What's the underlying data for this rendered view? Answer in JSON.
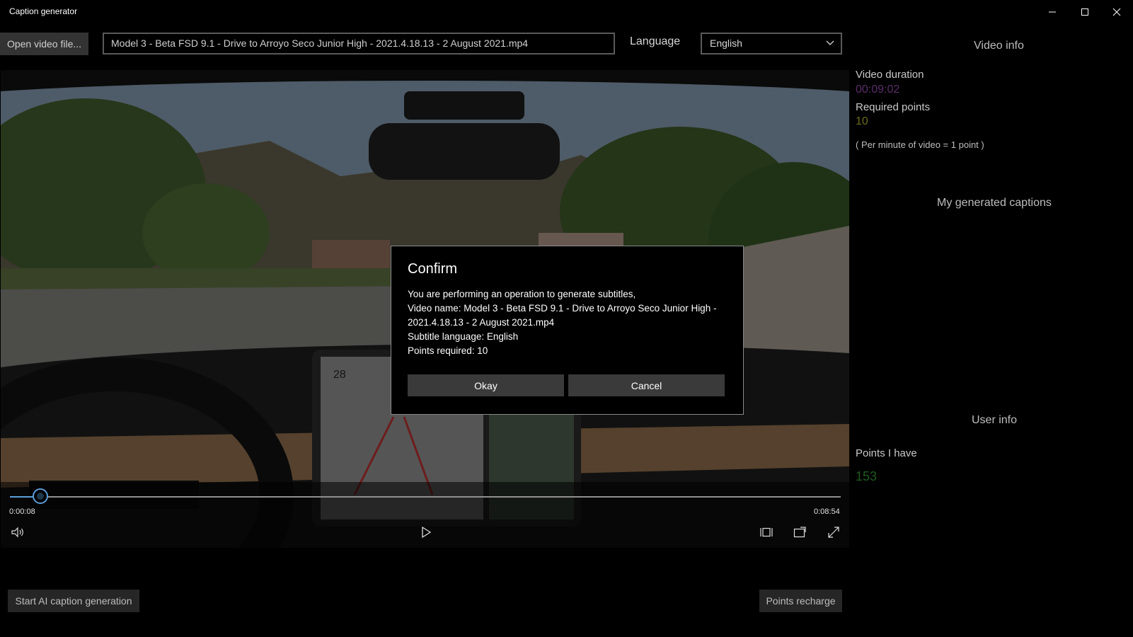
{
  "window": {
    "title": "Caption generator"
  },
  "toolbar": {
    "open_label": "Open video file...",
    "file_value": "Model 3 - Beta FSD 9.1 - Drive to Arroyo Seco Junior High - 2021.4.18.13 - 2 August 2021.mp4",
    "language_label": "Language",
    "language_value": "English"
  },
  "player": {
    "current_time": "0:00:08",
    "end_time": "0:08:54",
    "progress_fraction": 0.015,
    "dash_numbers": "28"
  },
  "bottom": {
    "start_label": "Start AI caption generation",
    "recharge_label": "Points recharge"
  },
  "panel": {
    "video_info_title": "Video info",
    "duration_label": "Video duration",
    "duration_value": "00:09:02",
    "required_label": "Required points",
    "required_value": "10",
    "note": "( Per minute of video = 1 point )",
    "captions_title": "My generated captions",
    "user_info_title": "User info",
    "points_have_label": "Points I have",
    "points_have_value": "153"
  },
  "dialog": {
    "title": "Confirm",
    "line1": "You are performing an operation to generate subtitles,",
    "line2": "Video name: Model 3 - Beta FSD 9.1 - Drive to Arroyo Seco Junior High - 2021.4.18.13 - 2 August 2021.mp4",
    "line3": "Subtitle language: English",
    "line4": "Points required: 10",
    "okay_label": "Okay",
    "cancel_label": "Cancel"
  },
  "colors": {
    "duration": "#5a2d6a",
    "required": "#6b6b1e",
    "points_have": "#1f5a1f",
    "accent": "#5a9dd8"
  }
}
